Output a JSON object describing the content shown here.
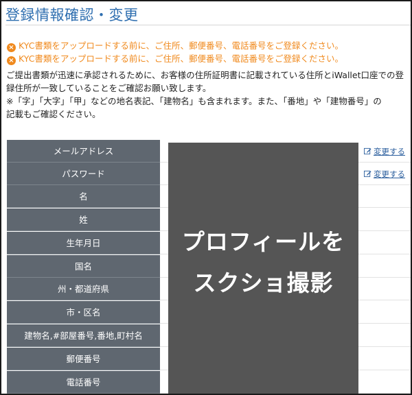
{
  "page": {
    "title": "登録情報確認・変更"
  },
  "warnings": [
    "KYC書類をアップロードする前に、ご住所、郵便番号、電話番号をご登録ください。",
    "KYC書類をアップロードする前に、ご住所、郵便番号、電話番号をご登録ください。"
  ],
  "notice": {
    "lines": [
      "ご提出書類が迅速に承認されるために、お客様の住所証明書に記載されている住所とiWallet口座での登",
      "録住所が一致していることをご確認お願い致します。",
      "※「字」「大字」「甲」などの地名表記、「建物名」も含まれます。また、「番地」や「建物番号」の",
      "記載もご確認ください。"
    ]
  },
  "profile_table": {
    "rows": [
      {
        "label": "メールアドレス",
        "action": "変更する"
      },
      {
        "label": "パスワード",
        "action": "変更する"
      },
      {
        "label": "名"
      },
      {
        "label": "姓"
      },
      {
        "label": "生年月日"
      },
      {
        "label": "国名"
      },
      {
        "label": "州・都道府県"
      },
      {
        "label": "市・区名"
      },
      {
        "label": "建物名,#部屋番号,番地,町村名"
      },
      {
        "label": "郵便番号"
      },
      {
        "label": "電話番号"
      }
    ]
  },
  "overlay": {
    "line1": "プロフィールを",
    "line2": "スクショ撮影"
  },
  "colors": {
    "title": "#2f6fb0",
    "warning": "#f08a1e",
    "label_bg": "#5f6770",
    "overlay_bg": "#555555",
    "link": "#2c5f9e"
  },
  "icons": {
    "warning": "close-circle-icon",
    "edit": "edit-pen-icon"
  }
}
